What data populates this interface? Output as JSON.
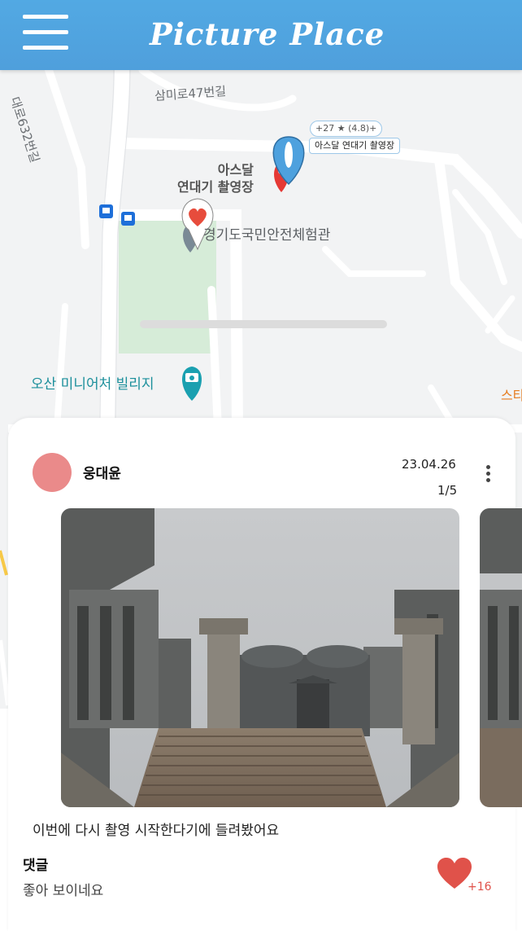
{
  "header": {
    "title": "Picture Place",
    "menu_icon": "hamburger-menu-icon",
    "background": "#4fa3df"
  },
  "map": {
    "road_labels": [
      "삼미로47번길",
      "대로632번길"
    ],
    "pois": {
      "filming_site": "아스달\n연대기 촬영장",
      "safety_center": "경기도국민안전체험관",
      "miniature_village": "오산 미니어처 빌리지",
      "edge_label": "스타"
    },
    "marker_bubble": {
      "rating": "+27 ★ (4.8)+",
      "place_name": "아스달 연대기 촬영장"
    },
    "icons": [
      "bus-stop-icon",
      "blue-location-pin-icon",
      "red-location-pin-icon",
      "heart-marker-icon",
      "camera-pin-icon"
    ]
  },
  "post": {
    "author": "웅대윤",
    "avatar_color": "#ea8a8a",
    "date": "23.04.26",
    "page": "1/5",
    "caption": "이번에 다시 촬영 시작한다기에 들려봤어요",
    "comments_label": "댓글",
    "comment": "좋아 보이네요",
    "likes": "+16",
    "like_color": "#e0524a"
  }
}
